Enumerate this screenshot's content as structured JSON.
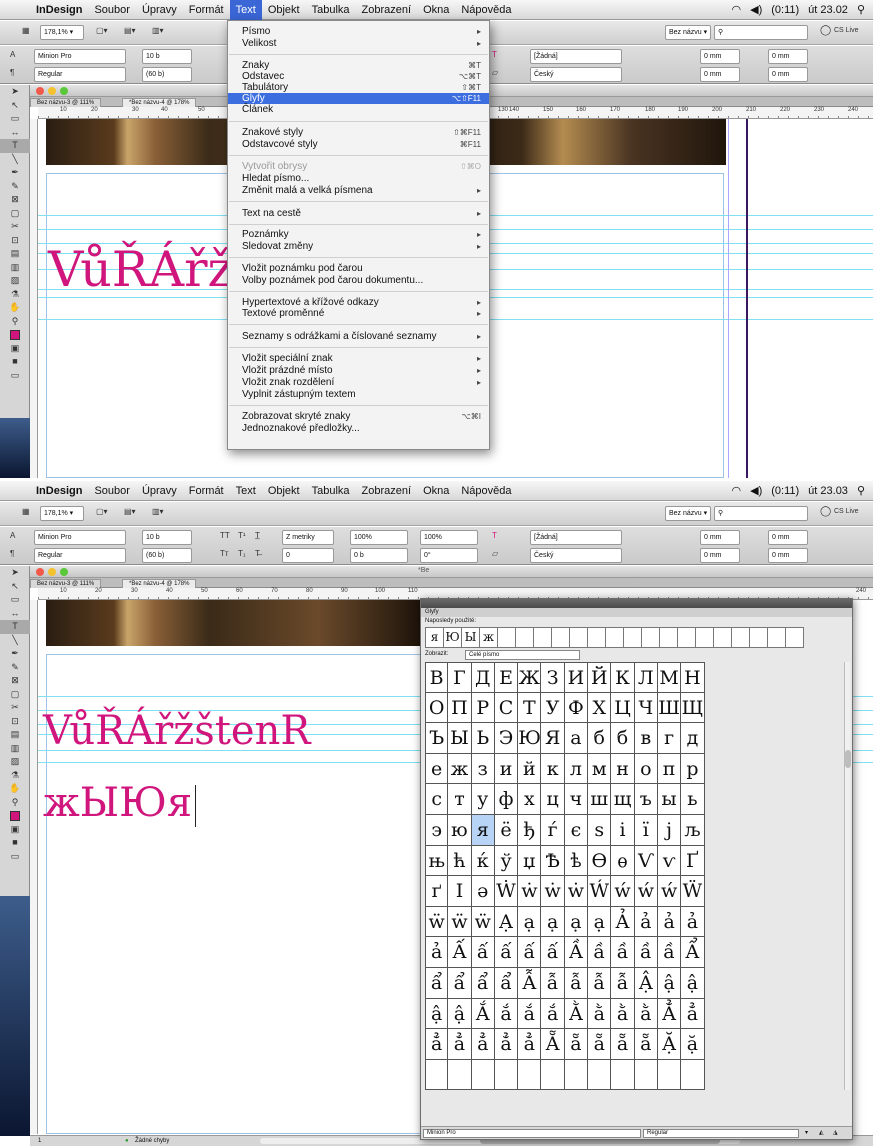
{
  "top": {
    "menubar": {
      "app_name": "InDesign",
      "items": [
        "Soubor",
        "Úpravy",
        "Formát",
        "Text",
        "Objekt",
        "Tabulka",
        "Zobrazení",
        "Okna",
        "Nápověda"
      ],
      "active_item": "Text",
      "clock": "út 23.02",
      "battery": "(0:11)"
    },
    "toolbar": {
      "zoom": "178,1% ▾",
      "doc_name": "Bez názvu ▾",
      "cs_live": "CS Live"
    },
    "control": {
      "font": "Minion Pro",
      "style": "Regular",
      "size": "10 b",
      "leading": "(60 b)",
      "swatch": "[Žádná]",
      "language": "Český",
      "mm1": "0 mm",
      "mm2": "0 mm",
      "mm3": "0 mm",
      "mm4": "0 mm"
    },
    "doc": {
      "tab1": "Bez názvu-3 @ 111%",
      "tab2": "*Bez názvu-4 @ 178%",
      "ruler": [
        "10",
        "20",
        "30",
        "40",
        "50",
        "130",
        "140",
        "150",
        "160",
        "170",
        "180",
        "190",
        "200",
        "210",
        "220",
        "230",
        "240"
      ],
      "big_text": "VůŘÁřž"
    },
    "menu": {
      "items": [
        {
          "label": "Písmo",
          "shortcut": "▸"
        },
        {
          "label": "Velikost",
          "shortcut": "▸"
        },
        {
          "label": "Znaky",
          "shortcut": "⌘T"
        },
        {
          "label": "Odstavec",
          "shortcut": "⌥⌘T"
        },
        {
          "label": "Tabulátory",
          "shortcut": "⇧⌘T"
        },
        {
          "label": "Glyfy",
          "shortcut": "⌥⇧F11"
        },
        {
          "label": "Článek",
          "shortcut": ""
        },
        {
          "label": "Znakové styly",
          "shortcut": "⇧⌘F11"
        },
        {
          "label": "Odstavcové styly",
          "shortcut": "⌘F11"
        },
        {
          "label": "Vytvořit obrysy",
          "shortcut": "⇧⌘O"
        },
        {
          "label": "Hledat písmo...",
          "shortcut": ""
        },
        {
          "label": "Změnit malá a velká písmena",
          "shortcut": "▸"
        },
        {
          "label": "Text na cestě",
          "shortcut": "▸"
        },
        {
          "label": "Poznámky",
          "shortcut": "▸"
        },
        {
          "label": "Sledovat změny",
          "shortcut": "▸"
        },
        {
          "label": "Vložit poznámku pod čarou",
          "shortcut": ""
        },
        {
          "label": "Volby poznámek pod čarou dokumentu...",
          "shortcut": ""
        },
        {
          "label": "Hypertextové a křížové odkazy",
          "shortcut": "▸"
        },
        {
          "label": "Textové proměnné",
          "shortcut": "▸"
        },
        {
          "label": "Seznamy s odrážkami a číslované seznamy",
          "shortcut": "▸"
        },
        {
          "label": "Vložit speciální znak",
          "shortcut": "▸"
        },
        {
          "label": "Vložit prázdné místo",
          "shortcut": "▸"
        },
        {
          "label": "Vložit znak rozdělení",
          "shortcut": "▸"
        },
        {
          "label": "Vyplnit zástupným textem",
          "shortcut": ""
        },
        {
          "label": "Zobrazovat skryté znaky",
          "shortcut": "⌥⌘I"
        },
        {
          "label": "Jednoznakové předložky...",
          "shortcut": ""
        }
      ]
    }
  },
  "bottom": {
    "menubar": {
      "app_name": "InDesign",
      "items": [
        "Soubor",
        "Úpravy",
        "Formát",
        "Text",
        "Objekt",
        "Tabulka",
        "Zobrazení",
        "Okna",
        "Nápověda"
      ],
      "clock": "út 23.03",
      "battery": "(0:11)"
    },
    "toolbar": {
      "zoom": "178,1% ▾",
      "doc_name": "Bez názvu ▾",
      "cs_live": "CS Live"
    },
    "control": {
      "font": "Minion Pro",
      "style": "Regular",
      "size": "10 b",
      "leading": "(60 b)",
      "kerning": "Z metriky",
      "scale": "100%",
      "scale2": "100%",
      "baseline": "0 b",
      "tracking": "0",
      "skew": "0°",
      "swatch": "[Žádná]",
      "language": "Český",
      "mm1": "0 mm",
      "mm2": "0 mm",
      "mm3": "0 mm",
      "mm4": "0 mm"
    },
    "doc": {
      "tab1": "Bez názvu-3 @ 111%",
      "tab2": "*Bez názvu-4 @ 178%",
      "title_frag": "*Be",
      "ruler": [
        "10",
        "20",
        "30",
        "40",
        "50",
        "60",
        "70",
        "80",
        "90",
        "100",
        "110",
        "240"
      ],
      "line1": "VůŘÁřžštenR",
      "line2": "жЫЮя"
    },
    "glyphs": {
      "title": "Glyfy",
      "recent_label": "Naposledy použité:",
      "recent": [
        "я",
        "Ю",
        "Ы",
        "ж"
      ],
      "show_label": "Zobrazit:",
      "show_value": "Celé písmo",
      "font": "Minion Pro",
      "style": "Regular",
      "selected": "я",
      "rows": [
        [
          "В",
          "Г",
          "Д",
          "Е",
          "Ж",
          "З",
          "И",
          "Й",
          "К",
          "Л",
          "М",
          "Н"
        ],
        [
          "О",
          "П",
          "Р",
          "С",
          "Т",
          "У",
          "Ф",
          "Х",
          "Ц",
          "Ч",
          "Ш",
          "Щ"
        ],
        [
          "Ъ",
          "Ы",
          "Ь",
          "Э",
          "Ю",
          "Я",
          "а",
          "б",
          "б",
          "в",
          "г",
          "д"
        ],
        [
          "е",
          "ж",
          "з",
          "и",
          "й",
          "к",
          "л",
          "м",
          "н",
          "о",
          "п",
          "р"
        ],
        [
          "с",
          "т",
          "у",
          "ф",
          "х",
          "ц",
          "ч",
          "ш",
          "щ",
          "ъ",
          "ы",
          "ь"
        ],
        [
          "э",
          "ю",
          "я",
          "ё",
          "ђ",
          "ѓ",
          "є",
          "ѕ",
          "і",
          "ї",
          "ј",
          "љ"
        ],
        [
          "њ",
          "ћ",
          "ќ",
          "ў",
          "џ",
          "Ѣ",
          "ѣ",
          "Ѳ",
          "ѳ",
          "Ѵ",
          "ѵ",
          "Ґ"
        ],
        [
          "ґ",
          "Ӏ",
          "ә",
          "Ẇ",
          "ẇ",
          "ẇ",
          "ẇ",
          "Ẃ",
          "ẃ",
          "ẃ",
          "ẃ",
          "Ẅ"
        ],
        [
          "ẅ",
          "ẅ",
          "ẅ",
          "Ạ",
          "ạ",
          "ạ",
          "ạ",
          "ạ",
          "Ả",
          "ả",
          "ả",
          "ả"
        ],
        [
          "ả",
          "Ấ",
          "ấ",
          "ấ",
          "ấ",
          "ấ",
          "Ầ",
          "ầ",
          "ầ",
          "ầ",
          "ầ",
          "Ẩ"
        ],
        [
          "ẩ",
          "ẩ",
          "ẩ",
          "ẩ",
          "Ẫ",
          "ẫ",
          "ẫ",
          "ẫ",
          "ẫ",
          "Ậ",
          "ậ",
          "ậ"
        ],
        [
          "ậ",
          "ậ",
          "Ắ",
          "ắ",
          "ắ",
          "ắ",
          "Ằ",
          "ằ",
          "ằ",
          "ằ",
          "Ẳ",
          "ẳ"
        ],
        [
          "ẳ",
          "ẳ",
          "ẳ",
          "ẳ",
          "ẳ",
          "Ẵ",
          "ẵ",
          "ẵ",
          "ẵ",
          "ẵ",
          "Ặ",
          "ặ"
        ],
        [
          "",
          "",
          "",
          "",
          "",
          "",
          "",
          "",
          "",
          "",
          "",
          ""
        ]
      ]
    },
    "status": {
      "page": "1",
      "errors": "Žádné chyby"
    }
  }
}
